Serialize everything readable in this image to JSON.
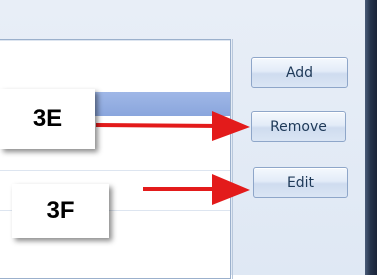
{
  "buttons": {
    "add_label": "Add",
    "remove_label": "Remove",
    "edit_label": "Edit"
  },
  "annotations": {
    "callout_3e": "3E",
    "callout_3f": "3F",
    "arrow_color": "#e31b1b"
  },
  "colors": {
    "selected_row": "#9fb7e7",
    "button_text": "#1e3958"
  }
}
